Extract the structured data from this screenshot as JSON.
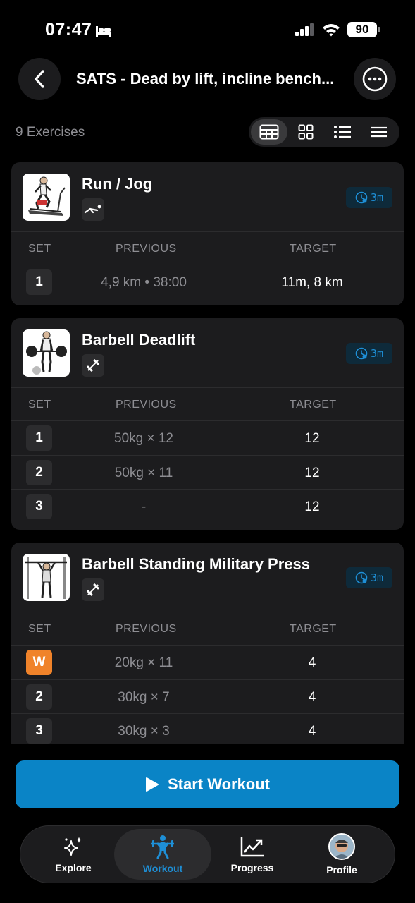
{
  "status": {
    "time": "07:47",
    "battery": "90"
  },
  "header": {
    "title": "SATS - Dead by lift, incline bench..."
  },
  "toolbar": {
    "exercise_count": "9 Exercises"
  },
  "table_headers": {
    "set": "SET",
    "previous": "PREVIOUS",
    "target": "TARGET"
  },
  "exercises": [
    {
      "name": "Run / Jog",
      "equipment_icon": "bodyweight-icon",
      "rest": "3m",
      "sets": [
        {
          "set": "1",
          "previous": "4,9 km • 38:00",
          "target": "11m, 8 km"
        }
      ]
    },
    {
      "name": "Barbell Deadlift",
      "equipment_icon": "barbell-icon",
      "rest": "3m",
      "sets": [
        {
          "set": "1",
          "previous": "50kg × 12",
          "target": "12"
        },
        {
          "set": "2",
          "previous": "50kg × 11",
          "target": "12"
        },
        {
          "set": "3",
          "previous": "-",
          "target": "12"
        }
      ]
    },
    {
      "name": "Barbell Standing Military Press",
      "equipment_icon": "barbell-icon",
      "rest": "3m",
      "sets": [
        {
          "set": "W",
          "previous": "20kg × 11",
          "target": "4"
        },
        {
          "set": "2",
          "previous": "30kg × 7",
          "target": "4"
        },
        {
          "set": "3",
          "previous": "30kg × 3",
          "target": "4"
        }
      ]
    }
  ],
  "start_button": {
    "label": "Start Workout"
  },
  "tabs": [
    {
      "label": "Explore",
      "icon": "sparkles-icon"
    },
    {
      "label": "Workout",
      "icon": "weightlifter-icon",
      "active": true
    },
    {
      "label": "Progress",
      "icon": "chart-icon"
    },
    {
      "label": "Profile",
      "icon": "avatar"
    }
  ],
  "colors": {
    "accent": "#0a84c6",
    "warmup": "#f0832a",
    "card": "#1c1c1e"
  }
}
